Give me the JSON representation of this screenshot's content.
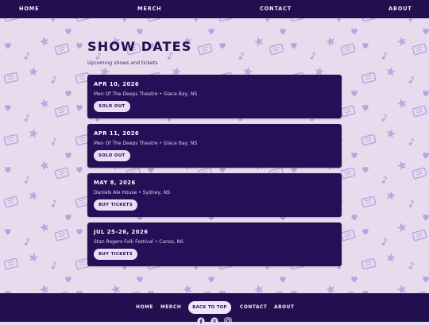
{
  "nav": {
    "home": "HOME",
    "merch": "MERCH",
    "contact": "CONTACT",
    "about": "ABOUT"
  },
  "page": {
    "title": "SHOW DATES",
    "subtitle": "Upcoming shows and tickets"
  },
  "shows": [
    {
      "date": "APR 10, 2026",
      "venue": "Men Of The Deeps Theatre • Glace Bay, NS",
      "button": "SOLD OUT"
    },
    {
      "date": "APR 11, 2026",
      "venue": "Men Of The Deeps Theatre • Glace Bay, NS",
      "button": "SOLD OUT"
    },
    {
      "date": "MAY 8, 2026",
      "venue": "Daniels Ale House • Sydney, NS",
      "button": "BUY TICKETS"
    },
    {
      "date": "JUL 25–26, 2026",
      "venue": "Stan Rogers Folk Festival • Canso, NS",
      "button": "BUY TICKETS"
    }
  ],
  "footer": {
    "home": "HOME",
    "merch": "MERCH",
    "back_to_top": "BACK TO TOP",
    "contact": "CONTACT",
    "about": "ABOUT",
    "social_icons": [
      "facebook-icon",
      "spotify-icon",
      "instagram-icon"
    ]
  },
  "colors": {
    "nav_bg": "#230f4f",
    "card_bg": "#250f57",
    "page_bg": "#e7dcee",
    "pattern": "#b9a4dd",
    "button_bg": "#e9ddf6"
  }
}
